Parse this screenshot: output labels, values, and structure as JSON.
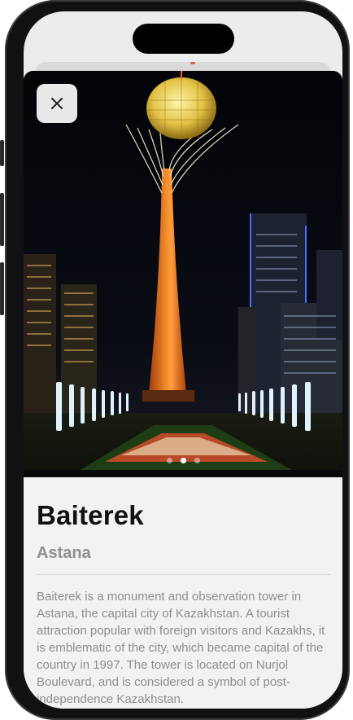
{
  "detail": {
    "close_icon": "close-icon",
    "image_alt": "Baiterek tower illuminated at night",
    "pager": {
      "count": 3,
      "active_index": 1
    },
    "title": "Baiterek",
    "subtitle": "Astana",
    "description": "Baiterek is a monument and observation tower in Astana, the capital city of Kazakhstan. A tourist attraction popular with foreign visitors and Kazakhs, it is emblematic of the city, which became capital of the country in 1997. The tower is located on Nurjol Boulevard, and is considered a symbol of post-independence Kazakhstan."
  },
  "colors": {
    "title": "#111111",
    "secondary_text": "#8e8e93",
    "sheet_background": "#f2f2f4",
    "tower_orange": "#e8701e",
    "sphere_gold": "#e6c84a"
  }
}
